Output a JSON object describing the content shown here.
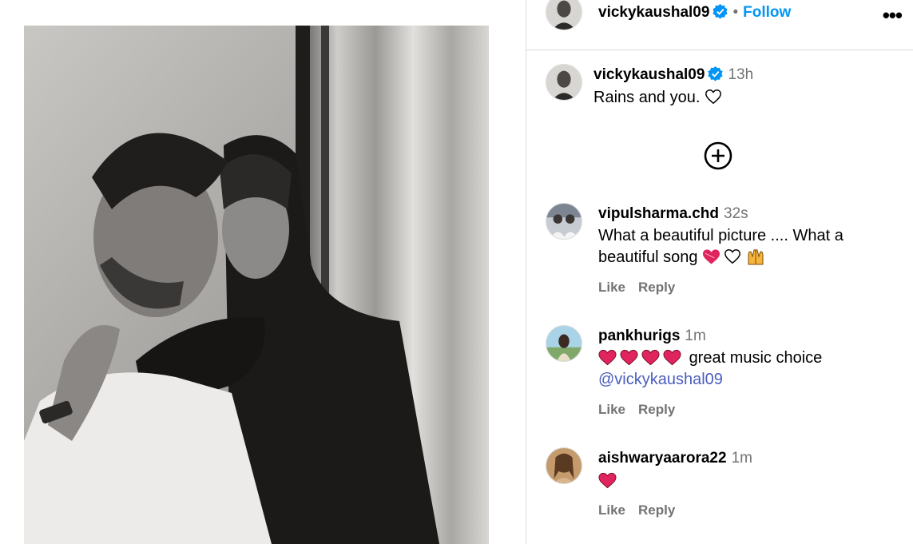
{
  "post": {
    "author": "vickykaushal09",
    "follow_label": "Follow",
    "dot": "•",
    "more_label": "•••",
    "caption_author": "vickykaushal09",
    "caption_time": "13h",
    "caption_text": "Rains and you."
  },
  "comments": [
    {
      "username": "vipulsharma.chd",
      "time": "32s",
      "line1": "What a beautiful picture .... What a",
      "line2": "beautiful song",
      "like_label": "Like",
      "reply_label": "Reply"
    },
    {
      "username": "pankhurigs",
      "time": "1m",
      "text": "great music choice",
      "mention": "@vickykaushal09",
      "like_label": "Like",
      "reply_label": "Reply"
    },
    {
      "username": "aishwaryaarora22",
      "time": "1m",
      "like_label": "Like",
      "reply_label": "Reply"
    }
  ],
  "colors": {
    "follow": "#0095f6",
    "verified": "#0095f6",
    "heart_red": "#e0245e",
    "muted": "#737373",
    "divider": "#dbdbdb"
  },
  "icons": [
    "verified-badge-icon",
    "more-options-icon",
    "heart-outline-icon",
    "add-circle-icon",
    "red-heart-emoji",
    "raised-hands-emoji"
  ]
}
